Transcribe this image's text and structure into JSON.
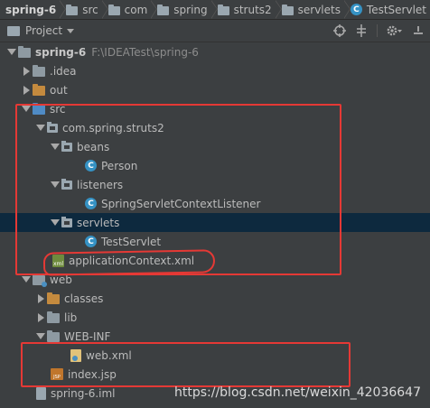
{
  "breadcrumb": {
    "items": [
      "spring-6",
      "src",
      "com",
      "spring",
      "struts2",
      "servlets",
      "TestServlet"
    ]
  },
  "toolbar": {
    "project_label": "Project",
    "icons": [
      "crosshair-icon",
      "collapse-icon",
      "gear-icon",
      "hide-icon"
    ]
  },
  "tree": {
    "root_label": "spring-6",
    "root_path": "F:\\IDEATest\\spring-6",
    "idea": ".idea",
    "out": "out",
    "src": "src",
    "pkg": "com.spring.struts2",
    "beans": "beans",
    "person": "Person",
    "listeners": "listeners",
    "listener_class": "SpringServletContextListener",
    "servlets": "servlets",
    "test_servlet": "TestServlet",
    "app_ctx": "applicationContext.xml",
    "web": "web",
    "classes": "classes",
    "lib": "lib",
    "webinf": "WEB-INF",
    "webxml": "web.xml",
    "indexjsp": "index.jsp",
    "iml": "spring-6.iml"
  },
  "watermark": "https://blog.csdn.net/weixin_42036647",
  "colors": {
    "background": "#3c3f41",
    "selection": "#0d293e",
    "highlight": "#e53935",
    "class_icon": "#3592c4"
  }
}
